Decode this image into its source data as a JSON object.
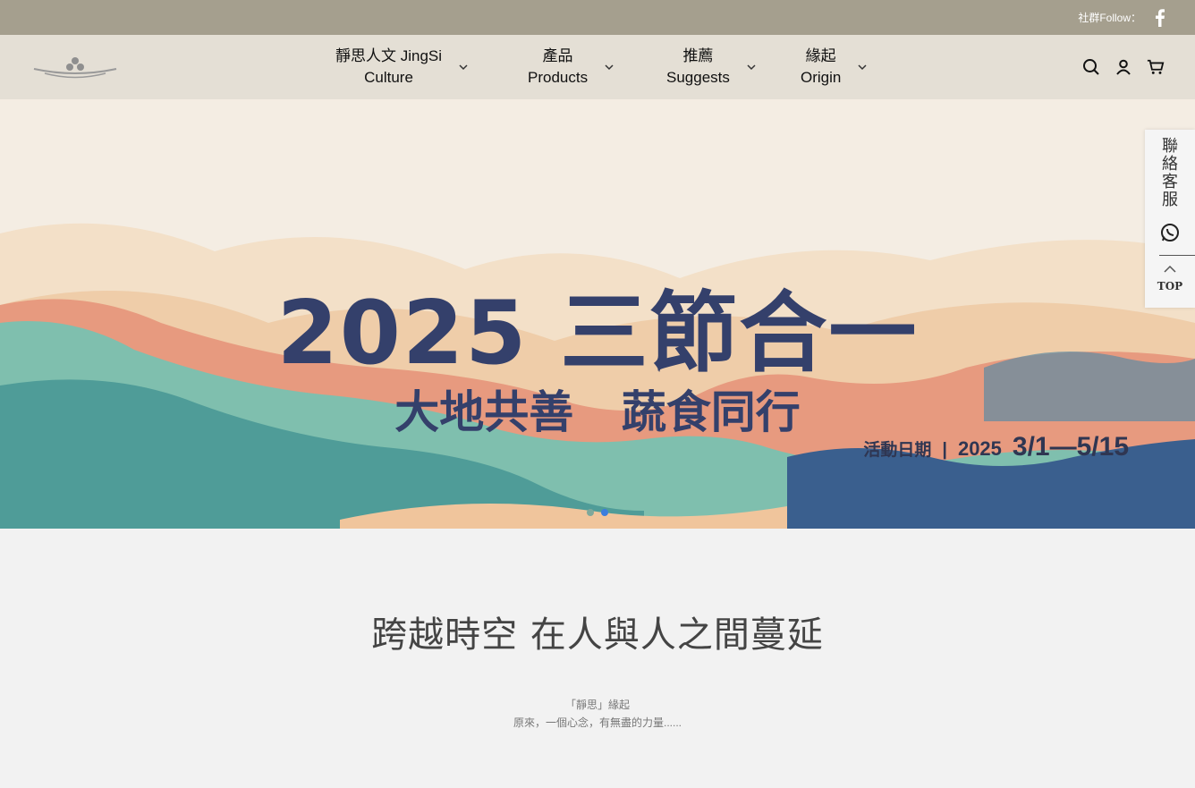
{
  "topbar": {
    "follow_label": "社群Follow：",
    "facebook_icon": "facebook-icon"
  },
  "header": {
    "nav": [
      {
        "line1": "靜思人文 JingSi",
        "line2": "Culture"
      },
      {
        "line1": "產品",
        "line2": "Products"
      },
      {
        "line1": "推薦",
        "line2": "Suggests"
      },
      {
        "line1": "緣起",
        "line2": "Origin"
      }
    ],
    "icons": [
      "search-icon",
      "account-icon",
      "cart-icon"
    ]
  },
  "banner": {
    "title": "2025 三節合一",
    "subtitle_left": "大地共善",
    "subtitle_right": "蔬食同行",
    "date_label": "活動日期",
    "date_sep": "|",
    "date_year": "2025",
    "date_range": "3/1—5/15",
    "slides": 2,
    "active_slide": 2
  },
  "sidebar": {
    "contact_label": [
      "聯",
      "絡",
      "客",
      "服"
    ],
    "top_label": "TOP"
  },
  "section": {
    "title": "跨越時空 在人與人之間蔓延",
    "line1": "「靜思」緣起",
    "line2": "原來，一個心念，有無盡的力量......"
  },
  "colors": {
    "topbar": "#a59f8e",
    "header": "#e4dfd5",
    "banner_text": "#34406b",
    "active_dot": "#3b7ddd"
  }
}
